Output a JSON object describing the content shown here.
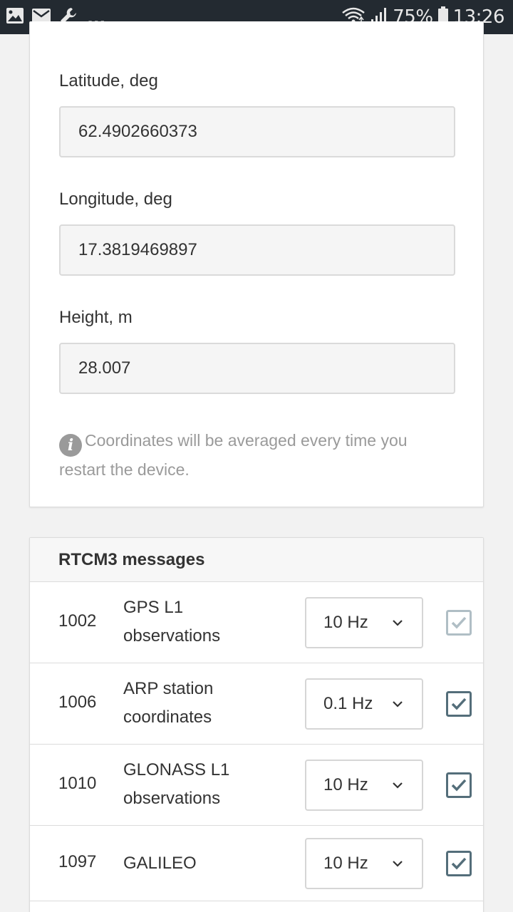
{
  "status_bar": {
    "battery_percent": "75%",
    "time": "13:26",
    "overflow": "...",
    "icons": [
      "image-icon",
      "mail-icon",
      "wrench-icon",
      "wifi-icon",
      "signal-icon",
      "battery-icon"
    ]
  },
  "base_coordinates": {
    "latitude": {
      "label": "Latitude, deg",
      "value": "62.4902660373"
    },
    "longitude": {
      "label": "Longitude, deg",
      "value": "17.3819469897"
    },
    "height": {
      "label": "Height, m",
      "value": "28.007"
    },
    "info_text": "Coordinates will be averaged every time you restart the device."
  },
  "rtcm3": {
    "title": "RTCM3 messages",
    "rows": [
      {
        "id": "1002",
        "name": "GPS L1 observations",
        "rate": "10 Hz",
        "enabled": true,
        "locked": true
      },
      {
        "id": "1006",
        "name": "ARP station coordinates",
        "rate": "0.1 Hz",
        "enabled": true,
        "locked": false
      },
      {
        "id": "1010",
        "name": "GLONASS L1 observations",
        "rate": "10 Hz",
        "enabled": true,
        "locked": false
      },
      {
        "id": "1097",
        "name": "GALILEO",
        "rate": "10 Hz",
        "enabled": true,
        "locked": false
      }
    ]
  },
  "colors": {
    "status_bar_bg": "#232a31",
    "checkbox_active": "#546e7a",
    "checkbox_disabled": "#b0bec5",
    "info_gray": "#9a9a9a"
  }
}
